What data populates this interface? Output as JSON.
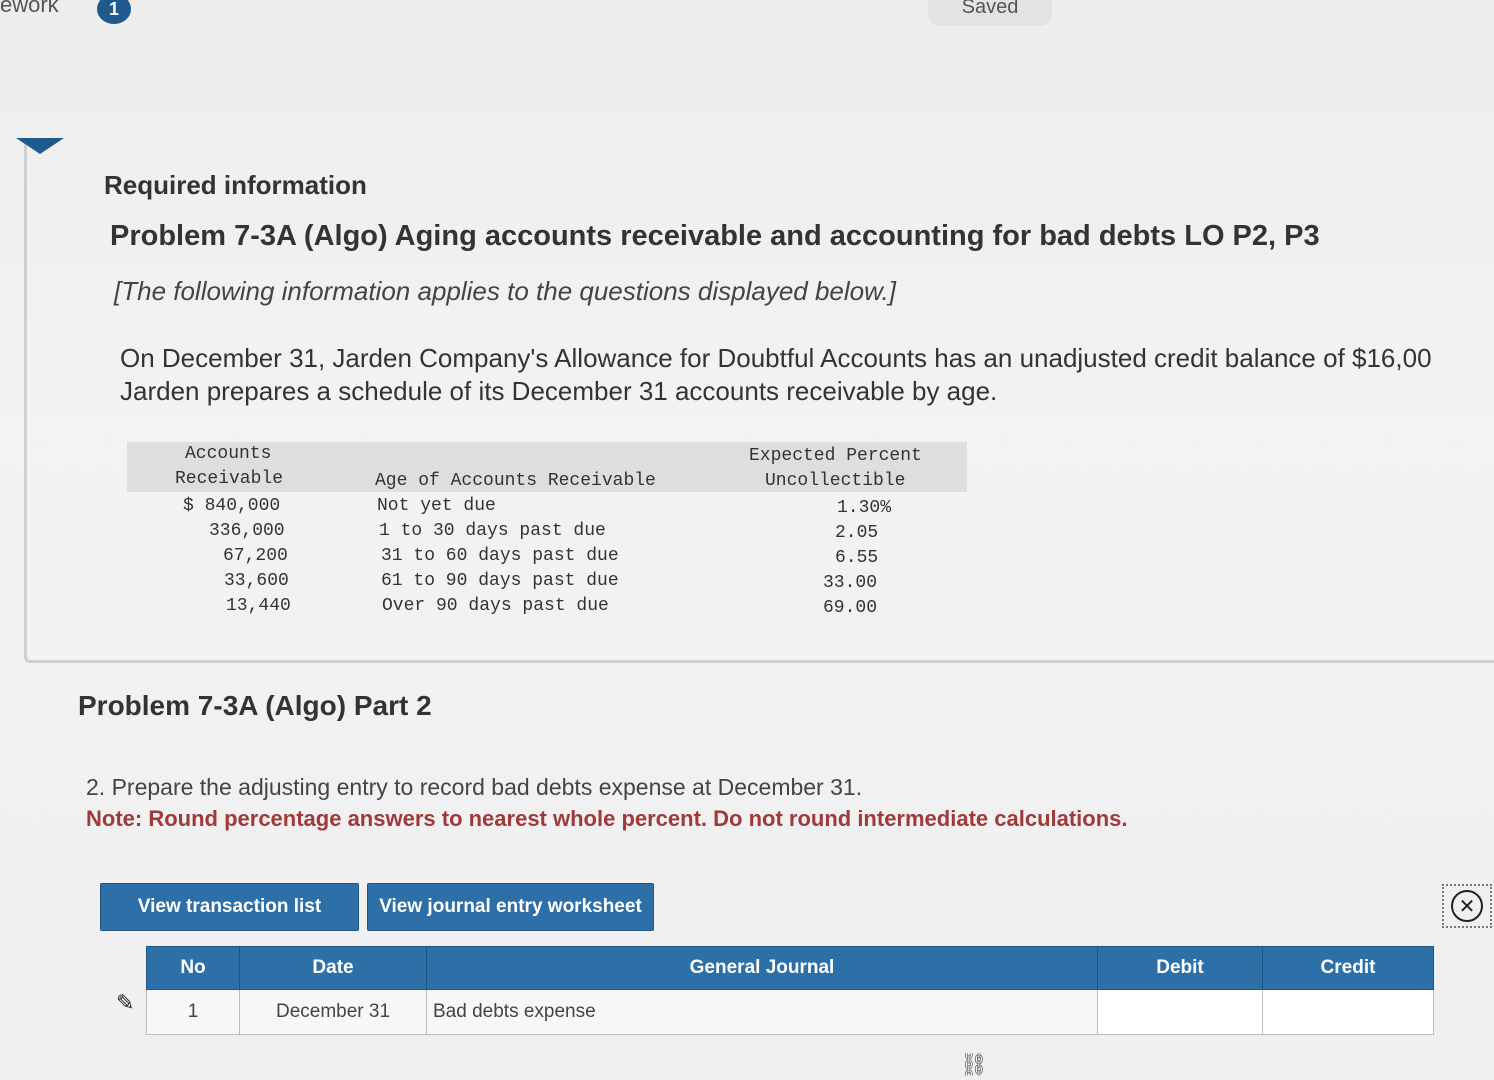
{
  "header": {
    "title": "ework",
    "badge_count": "1",
    "saved_label": "Saved"
  },
  "panel": {
    "required": "Required information",
    "title": "Problem 7-3A (Algo) Aging accounts receivable and accounting for bad debts LO P2, P3",
    "applies": "[The following information applies to the questions displayed below.]",
    "intro_line1": "On December 31, Jarden Company's Allowance for Doubtful Accounts has an unadjusted credit balance of $16,00",
    "intro_line2": "Jarden prepares a schedule of its December 31 accounts receivable by age."
  },
  "aging_table": {
    "headers": {
      "ar_line1": "Accounts",
      "ar_line2": "Receivable",
      "age": "Age of Accounts Receivable",
      "pct_line1": "Expected Percent",
      "pct_line2": "Uncollectible"
    },
    "rows": [
      {
        "amount": "$ 840,000",
        "age": "Not yet due",
        "pct": "1.30%"
      },
      {
        "amount": "336,000",
        "age": "1 to 30 days past due",
        "pct": "2.05"
      },
      {
        "amount": "67,200",
        "age": "31 to 60 days past due",
        "pct": "6.55"
      },
      {
        "amount": "33,600",
        "age": "61 to 90 days past due",
        "pct": "33.00"
      },
      {
        "amount": "13,440",
        "age": "Over 90 days past due",
        "pct": "69.00"
      }
    ]
  },
  "part": {
    "title": "Problem 7-3A (Algo) Part 2",
    "question": "2. Prepare the adjusting entry to record bad debts expense at December 31.",
    "note": "Note: Round percentage answers to nearest whole percent. Do not round intermediate calculations."
  },
  "buttons": {
    "view_transactions": "View transaction list",
    "view_journal": "View journal entry worksheet"
  },
  "journal": {
    "headers": {
      "no": "No",
      "date": "Date",
      "general_journal": "General Journal",
      "debit": "Debit",
      "credit": "Credit"
    },
    "rows": [
      {
        "no": "1",
        "date": "December 31",
        "account": "Bad debts expense",
        "debit": "",
        "credit": ""
      }
    ]
  },
  "icons": {
    "close": "close-circle-icon",
    "edit": "pencil-icon",
    "link": "link-icon"
  }
}
